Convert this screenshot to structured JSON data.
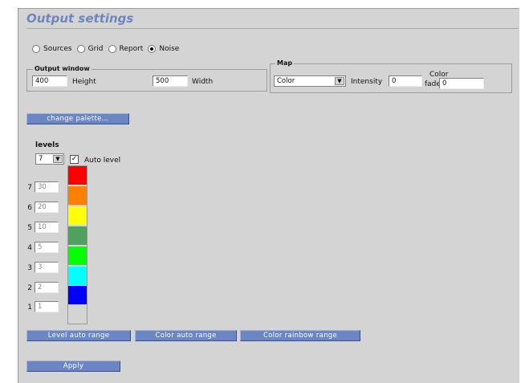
{
  "title": "Output settings",
  "output_type": {
    "options": [
      "Sources",
      "Grid",
      "Report",
      "Noise"
    ],
    "selected": "Noise"
  },
  "output_window": {
    "legend": "Output window",
    "height_value": "400",
    "height_label": "Height",
    "width_value": "500",
    "width_label": "Width"
  },
  "map": {
    "legend": "Map",
    "mode_value": "Color",
    "intensity_label": "Intensity",
    "intensity_value": "0",
    "color_fade_label_1": "Color",
    "color_fade_label_2": "fade",
    "color_fade_value": "0"
  },
  "buttons": {
    "change_palette": "change palette...",
    "level_auto_range": "Level auto range",
    "color_auto_range": "Color auto range",
    "color_rainbow_range": "Color rainbow range",
    "apply": "Apply"
  },
  "levels": {
    "label": "levels",
    "count_value": "7",
    "auto_level_label": "Auto level",
    "auto_level_checked": true,
    "rows": [
      {
        "num": "7",
        "value": "30",
        "color": "#ff0000"
      },
      {
        "num": "6",
        "value": "20",
        "color": "#ff8000"
      },
      {
        "num": "5",
        "value": "10",
        "color": "#ffff00"
      },
      {
        "num": "4",
        "value": "5",
        "color": "#50a060"
      },
      {
        "num": "3",
        "value": "3",
        "color": "#00ff00"
      },
      {
        "num": "2",
        "value": "2",
        "color": "#00ffff"
      },
      {
        "num": "1",
        "value": "1",
        "color": "#0000ff"
      }
    ]
  }
}
